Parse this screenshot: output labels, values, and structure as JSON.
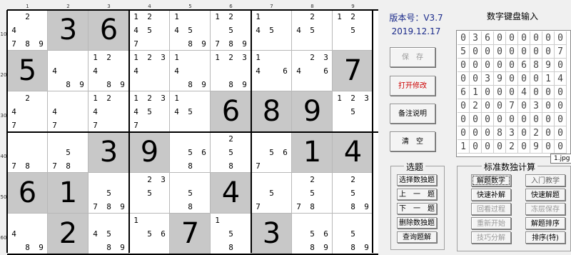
{
  "col_numbers": [
    "1",
    "2",
    "3",
    "4",
    "5",
    "6",
    "7",
    "8",
    "9"
  ],
  "row_numbers": [
    "10",
    "20",
    "30",
    "40",
    "50",
    "60"
  ],
  "board": [
    [
      {
        "c": [
          "",
          "2",
          "",
          "4",
          "",
          "",
          "7",
          "8",
          "9"
        ]
      },
      {
        "v": "3"
      },
      {
        "v": "6"
      },
      {
        "c": [
          "1",
          "2",
          "",
          "4",
          "5",
          "",
          "7",
          "",
          ""
        ]
      },
      {
        "c": [
          "1",
          "",
          "",
          "4",
          "5",
          "",
          "",
          "8",
          "9"
        ]
      },
      {
        "c": [
          "1",
          "2",
          "",
          "",
          "5",
          "",
          "7",
          "8",
          "9"
        ]
      },
      {
        "c": [
          "1",
          "",
          "",
          "4",
          "5",
          "",
          "",
          "",
          ""
        ]
      },
      {
        "c": [
          "",
          "2",
          "",
          "4",
          "5",
          "",
          "",
          "",
          ""
        ]
      },
      {
        "c": [
          "1",
          "2",
          "",
          "",
          "5",
          "",
          "",
          "",
          ""
        ]
      }
    ],
    [
      {
        "v": "5"
      },
      {
        "c": [
          "",
          "",
          "",
          "4",
          "",
          "",
          "",
          "8",
          "9"
        ]
      },
      {
        "c": [
          "1",
          "2",
          "",
          "4",
          "",
          "",
          "",
          "8",
          "9"
        ]
      },
      {
        "c": [
          "1",
          "2",
          "3",
          "4",
          "",
          "",
          "",
          "",
          ""
        ]
      },
      {
        "c": [
          "1",
          "",
          "",
          "4",
          "",
          "",
          "",
          "8",
          "9"
        ]
      },
      {
        "c": [
          "1",
          "2",
          "3",
          "",
          "",
          "",
          "",
          "8",
          "9"
        ]
      },
      {
        "c": [
          "1",
          "",
          "",
          "4",
          "",
          "6",
          "",
          "",
          ""
        ]
      },
      {
        "c": [
          "",
          "2",
          "3",
          "4",
          "",
          "6",
          "",
          "",
          ""
        ]
      },
      {
        "v": "7"
      }
    ],
    [
      {
        "c": [
          "",
          "2",
          "",
          "4",
          "",
          "",
          "7",
          "",
          ""
        ]
      },
      {
        "c": [
          "",
          "",
          "",
          "4",
          "",
          "",
          "7",
          "",
          ""
        ]
      },
      {
        "c": [
          "1",
          "2",
          "",
          "4",
          "",
          "",
          "7",
          "",
          ""
        ]
      },
      {
        "c": [
          "1",
          "2",
          "3",
          "4",
          "5",
          "",
          "7",
          "",
          ""
        ]
      },
      {
        "c": [
          "1",
          "",
          "",
          "4",
          "5",
          "",
          "",
          "",
          ""
        ]
      },
      {
        "v": "6"
      },
      {
        "v": "8"
      },
      {
        "v": "9"
      },
      {
        "c": [
          "1",
          "2",
          "3",
          "",
          "5",
          "",
          "",
          "",
          ""
        ]
      }
    ],
    [
      {
        "c": [
          "",
          "",
          "",
          "",
          "",
          "",
          "7",
          "8",
          ""
        ]
      },
      {
        "c": [
          "",
          "",
          "",
          "",
          "5",
          "",
          "7",
          "8",
          ""
        ]
      },
      {
        "v": "3"
      },
      {
        "v": "9"
      },
      {
        "c": [
          "",
          "",
          "",
          "",
          "5",
          "6",
          "",
          "8",
          ""
        ]
      },
      {
        "c": [
          "",
          "2",
          "",
          "",
          "5",
          "",
          "",
          "8",
          ""
        ]
      },
      {
        "c": [
          "",
          "",
          "",
          "",
          "5",
          "6",
          "7",
          "",
          ""
        ]
      },
      {
        "v": "1"
      },
      {
        "v": "4"
      }
    ],
    [
      {
        "v": "6"
      },
      {
        "v": "1"
      },
      {
        "c": [
          "",
          "",
          "",
          "",
          "5",
          "",
          "7",
          "8",
          "9"
        ]
      },
      {
        "c": [
          "",
          "2",
          "3",
          "",
          "5",
          "",
          "",
          "",
          ""
        ]
      },
      {
        "c": [
          "",
          "",
          "",
          "",
          "5",
          "",
          "",
          "8",
          ""
        ]
      },
      {
        "v": "4"
      },
      {
        "c": [
          "",
          "",
          "",
          "",
          "5",
          "",
          "7",
          "",
          ""
        ]
      },
      {
        "c": [
          "",
          "2",
          "",
          "",
          "5",
          "",
          "7",
          "8",
          ""
        ]
      },
      {
        "c": [
          "",
          "2",
          "",
          "",
          "5",
          "",
          "",
          "8",
          "9"
        ]
      }
    ],
    [
      {
        "c": [
          "",
          "",
          "",
          "4",
          "",
          "",
          "",
          "8",
          "9"
        ]
      },
      {
        "v": "2"
      },
      {
        "c": [
          "",
          "",
          "",
          "4",
          "5",
          "",
          "",
          "8",
          "9"
        ]
      },
      {
        "c": [
          "1",
          "",
          "",
          "",
          "5",
          "6",
          "",
          "",
          ""
        ]
      },
      {
        "v": "7"
      },
      {
        "c": [
          "1",
          "",
          "",
          "",
          "5",
          "",
          "",
          "8",
          ""
        ]
      },
      {
        "v": "3"
      },
      {
        "c": [
          "",
          "",
          "",
          "",
          "5",
          "6",
          "",
          "8",
          "9"
        ]
      },
      {
        "c": [
          "",
          "",
          "",
          "",
          "5",
          "",
          "",
          "8",
          "9"
        ]
      }
    ]
  ],
  "version": {
    "label": "版本号：V3.7",
    "date": "2019.12.17"
  },
  "buttons": {
    "save": "保　存",
    "open_edit": "打开修改",
    "notes": "备注说明",
    "clear": "清　空"
  },
  "select_group": {
    "title": "选题",
    "select": "选择数独题",
    "prev": "上　一　题",
    "next": "下　一　题",
    "delete": "删除数独题",
    "query": "查询题解"
  },
  "calc_group": {
    "title": "标准数独计算",
    "solve_num": "解题数字",
    "intro": "入门教学",
    "fast_find": "快速补解",
    "fast_solve": "快速解题",
    "review": "回看过程",
    "freeze_save": "冻层保存",
    "restart": "重新开始",
    "solve_sort": "解题排序",
    "skill": "技巧分解",
    "sort_special": "排序(特)"
  },
  "keypad": {
    "title": "数字键盘输入",
    "rows": [
      [
        "0",
        "3",
        "6",
        "0",
        "0",
        "0",
        "0",
        "0",
        "0"
      ],
      [
        "5",
        "0",
        "0",
        "0",
        "0",
        "0",
        "0",
        "0",
        "7"
      ],
      [
        "0",
        "0",
        "0",
        "0",
        "0",
        "6",
        "8",
        "9",
        "0"
      ],
      [
        "0",
        "0",
        "3",
        "9",
        "0",
        "0",
        "0",
        "1",
        "4"
      ],
      [
        "6",
        "1",
        "0",
        "0",
        "0",
        "4",
        "0",
        "0",
        "0"
      ],
      [
        "0",
        "2",
        "0",
        "0",
        "7",
        "0",
        "3",
        "0",
        "0"
      ],
      [
        "0",
        "0",
        "0",
        "0",
        "0",
        "0",
        "0",
        "0",
        "0"
      ],
      [
        "0",
        "0",
        "0",
        "8",
        "3",
        "0",
        "2",
        "0",
        "0"
      ],
      [
        "1",
        "0",
        "0",
        "0",
        "2",
        "0",
        "9",
        "0",
        "0"
      ]
    ]
  },
  "tooltip": "1.jpg"
}
